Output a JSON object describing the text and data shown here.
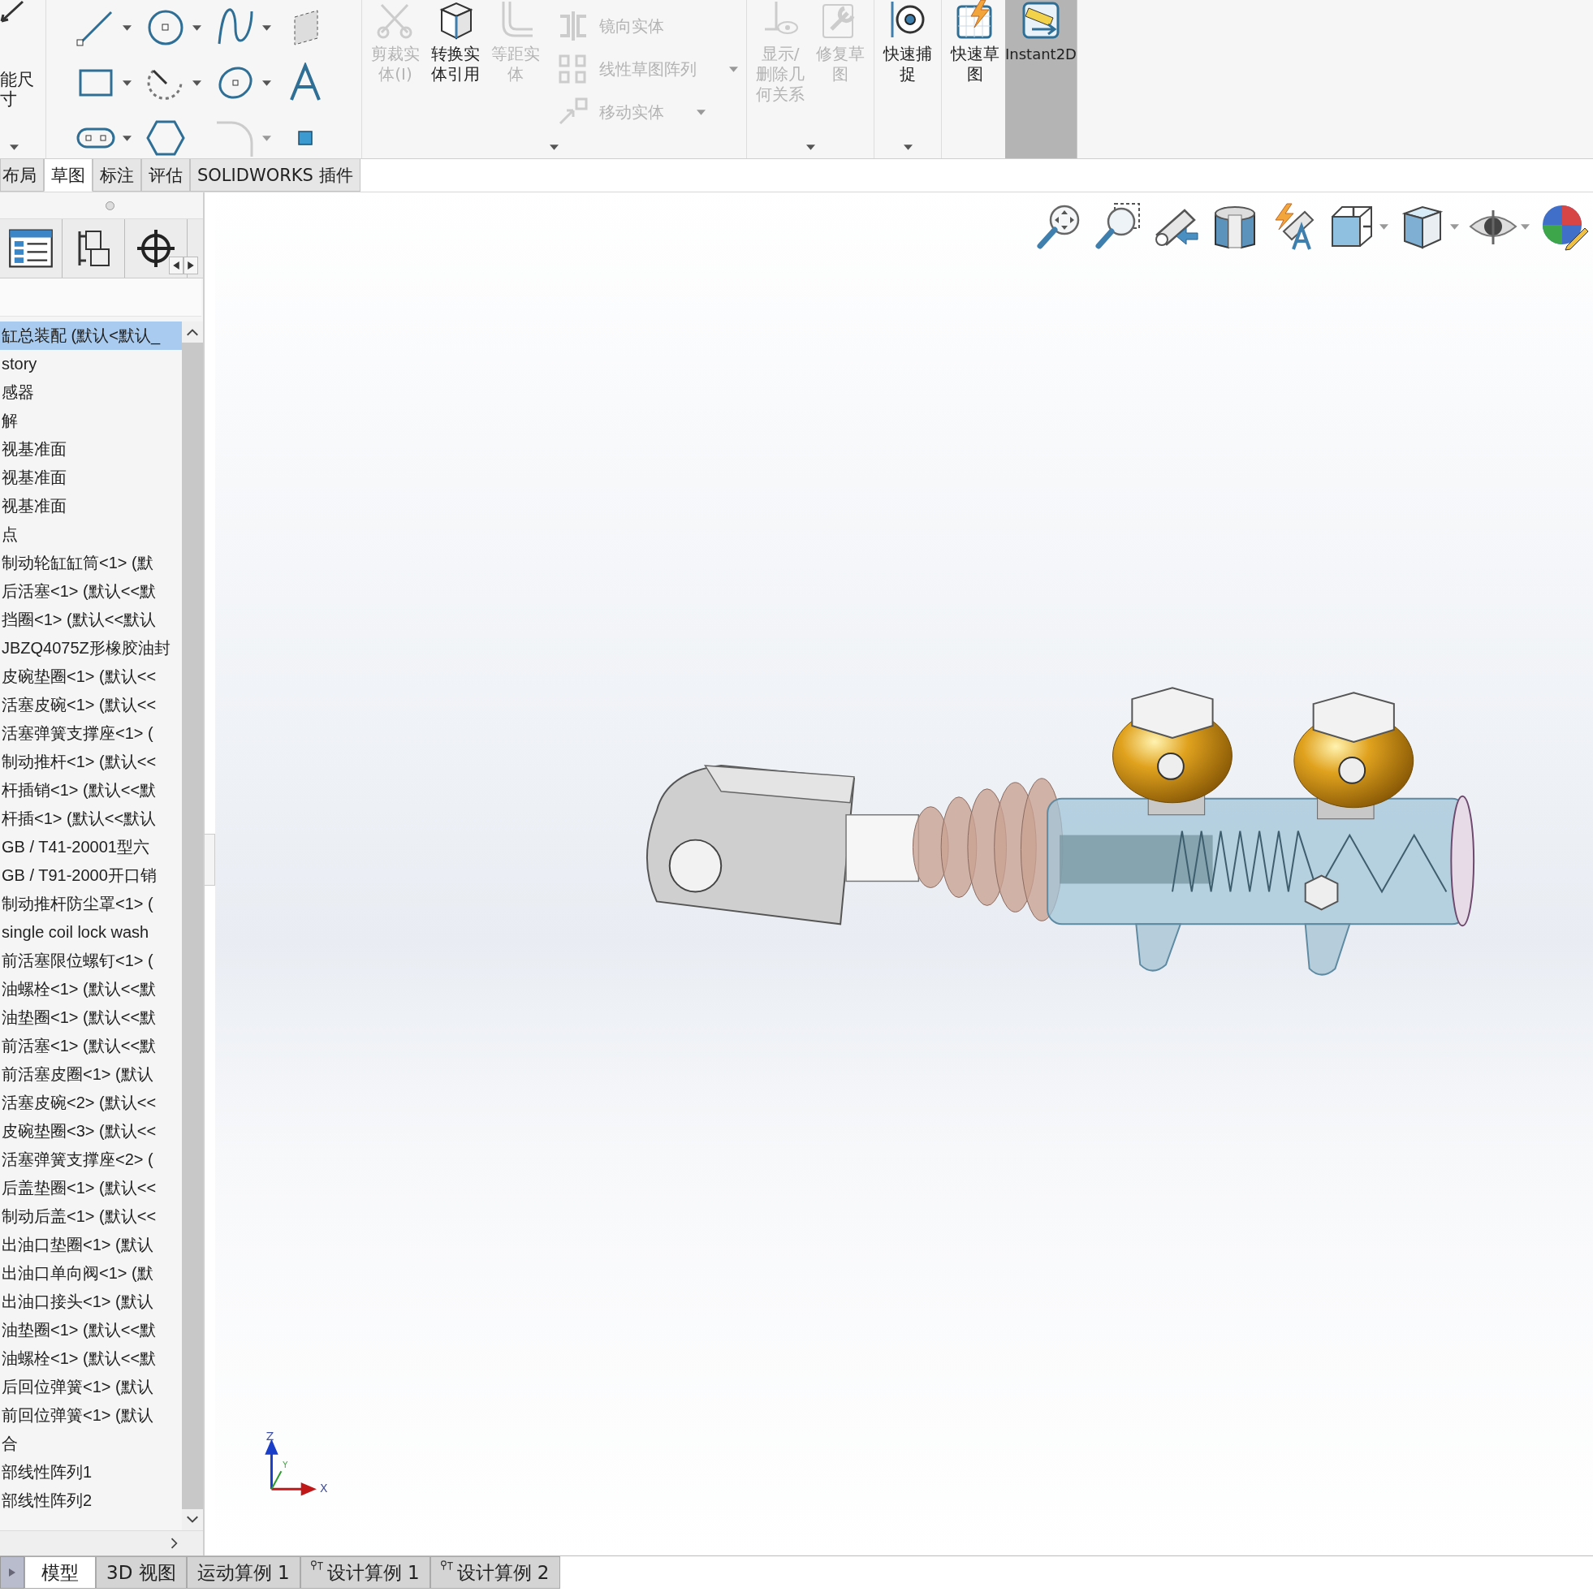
{
  "ribbon": {
    "dimension_label": "能尺寸",
    "groups": [
      {
        "commands": [
          {
            "kind": "large",
            "label": "剪裁实体(I)",
            "disabled": true,
            "on": false
          },
          {
            "kind": "large",
            "label": "转换实体引用",
            "disabled": false,
            "on": false
          },
          {
            "kind": "large",
            "label": "等距实体",
            "disabled": true,
            "on": false
          },
          {
            "kind": "stack",
            "items": [
              {
                "label": "镜向实体",
                "disabled": true
              },
              {
                "label": "线性草图阵列",
                "disabled": true
              },
              {
                "label": "移动实体",
                "disabled": true
              }
            ]
          }
        ]
      },
      {
        "commands": [
          {
            "kind": "large",
            "label": "显示/删除几何关系",
            "disabled": true,
            "on": false
          },
          {
            "kind": "large",
            "label": "修复草图",
            "disabled": true,
            "on": false
          }
        ]
      },
      {
        "commands": [
          {
            "kind": "large",
            "label": "快速捕捉",
            "disabled": false,
            "on": false
          }
        ]
      },
      {
        "commands": [
          {
            "kind": "large",
            "label": "快速草图",
            "disabled": false,
            "on": false
          },
          {
            "kind": "large",
            "label": "Instant2D",
            "disabled": false,
            "on": true
          }
        ]
      }
    ]
  },
  "command_tabs": [
    {
      "label": "布局",
      "selected": false
    },
    {
      "label": "草图",
      "selected": true
    },
    {
      "label": "标注",
      "selected": false
    },
    {
      "label": "评估",
      "selected": false
    },
    {
      "label": "SOLIDWORKS 插件",
      "selected": false
    }
  ],
  "feature_tree": {
    "items": [
      {
        "label": "缸总装配 (默认<默认_",
        "selected": true
      },
      {
        "label": "story",
        "selected": false
      },
      {
        "label": "感器",
        "selected": false
      },
      {
        "label": "解",
        "selected": false
      },
      {
        "label": "视基准面",
        "selected": false
      },
      {
        "label": "视基准面",
        "selected": false
      },
      {
        "label": "视基准面",
        "selected": false
      },
      {
        "label": "点",
        "selected": false
      },
      {
        "label": "制动轮缸缸筒<1> (默",
        "selected": false
      },
      {
        "label": "后活塞<1> (默认<<默",
        "selected": false
      },
      {
        "label": "挡圈<1> (默认<<默认",
        "selected": false
      },
      {
        "label": "JBZQ4075Z形橡胶油封",
        "selected": false
      },
      {
        "label": "皮碗垫圈<1> (默认<<",
        "selected": false
      },
      {
        "label": "活塞皮碗<1> (默认<<",
        "selected": false
      },
      {
        "label": "活塞弹簧支撑座<1> (",
        "selected": false
      },
      {
        "label": "制动推杆<1> (默认<<",
        "selected": false
      },
      {
        "label": "杆插销<1> (默认<<默",
        "selected": false
      },
      {
        "label": "杆插<1> (默认<<默认",
        "selected": false
      },
      {
        "label": "GB / T41-20001型六",
        "selected": false
      },
      {
        "label": "GB / T91-2000开口销",
        "selected": false
      },
      {
        "label": "制动推杆防尘罩<1> (",
        "selected": false
      },
      {
        "label": "single coil lock wash",
        "selected": false
      },
      {
        "label": "前活塞限位螺钉<1> (",
        "selected": false
      },
      {
        "label": "油螺栓<1> (默认<<默",
        "selected": false
      },
      {
        "label": "油垫圈<1> (默认<<默",
        "selected": false
      },
      {
        "label": "前活塞<1> (默认<<默",
        "selected": false
      },
      {
        "label": "前活塞皮圈<1> (默认",
        "selected": false
      },
      {
        "label": "活塞皮碗<2> (默认<<",
        "selected": false
      },
      {
        "label": "皮碗垫圈<3> (默认<<",
        "selected": false
      },
      {
        "label": "活塞弹簧支撑座<2> (",
        "selected": false
      },
      {
        "label": "后盖垫圈<1> (默认<<",
        "selected": false
      },
      {
        "label": "制动后盖<1> (默认<<",
        "selected": false
      },
      {
        "label": "出油口垫圈<1> (默认",
        "selected": false
      },
      {
        "label": "出油口单向阀<1> (默",
        "selected": false
      },
      {
        "label": "出油口接头<1> (默认",
        "selected": false
      },
      {
        "label": "油垫圈<1> (默认<<默",
        "selected": false
      },
      {
        "label": "油螺栓<1> (默认<<默",
        "selected": false
      },
      {
        "label": "后回位弹簧<1> (默认",
        "selected": false
      },
      {
        "label": "前回位弹簧<1> (默认",
        "selected": false
      },
      {
        "label": "合",
        "selected": false
      },
      {
        "label": "部线性阵列1",
        "selected": false
      },
      {
        "label": "部线性阵列2",
        "selected": false
      }
    ]
  },
  "triad": {
    "z": "Z",
    "y": "Y",
    "x": "X"
  },
  "bottom_tabs": [
    {
      "label": "模型",
      "selected": true,
      "kind": "plain"
    },
    {
      "label": "3D 视图",
      "selected": false,
      "kind": "plain"
    },
    {
      "label": "运动算例 1",
      "selected": false,
      "kind": "plain"
    },
    {
      "label": "设计算例 1",
      "selected": false,
      "kind": "study"
    },
    {
      "label": "设计算例 2",
      "selected": false,
      "kind": "study"
    }
  ]
}
